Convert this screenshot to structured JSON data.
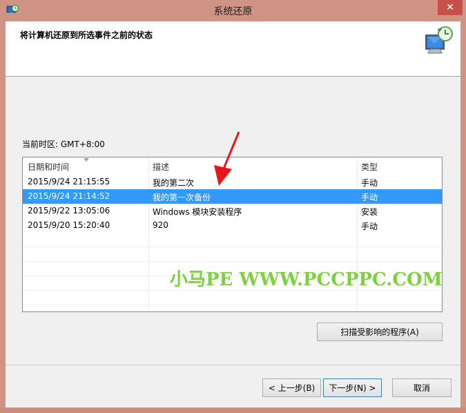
{
  "window": {
    "title": "系统还原",
    "close_glyph": "✕"
  },
  "header": {
    "title": "将计算机还原到所选事件之前的状态",
    "icon": "system-restore-icon"
  },
  "timezone": "当前时区: GMT+8:00",
  "list": {
    "columns": [
      "日期和时间",
      "描述",
      "类型"
    ],
    "rows": [
      {
        "datetime": "2015/9/24 21:15:55",
        "description": "我的第二次",
        "type": "手动",
        "selected": false
      },
      {
        "datetime": "2015/9/24 21:14:52",
        "description": "我的第一次备份",
        "type": "手动",
        "selected": true
      },
      {
        "datetime": "2015/9/22 13:05:06",
        "description": "Windows 模块安装程序",
        "type": "安装",
        "selected": false
      },
      {
        "datetime": "2015/9/20 15:20:40",
        "description": "920",
        "type": "手动",
        "selected": false
      }
    ]
  },
  "watermark": "小马PE WWW.PCCPPC.COM",
  "buttons": {
    "scan": "扫描受影响的程序(A)",
    "back": "< 上一步(B)",
    "next": "下一步(N) >",
    "cancel": "取消"
  },
  "colors": {
    "selection": "#3399ff",
    "arrow": "#e8161b",
    "watermark": "#7cd23c",
    "close": "#c7504c"
  }
}
